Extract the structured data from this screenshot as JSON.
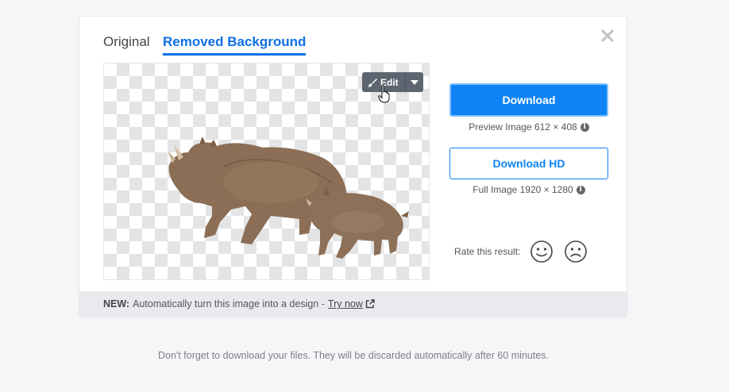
{
  "tabs": {
    "original": "Original",
    "removed_background": "Removed Background"
  },
  "preview": {
    "edit_label": "Edit",
    "edit_icon": "brush-icon",
    "dropdown_icon": "caret-down-icon"
  },
  "download": {
    "button_label": "Download",
    "preview_caption": "Preview Image 612 × 408",
    "hd_button_label": "Download HD",
    "hd_caption": "Full Image 1920 × 1280"
  },
  "rating": {
    "label": "Rate this result:",
    "positive_icon": "smiley-face-icon",
    "negative_icon": "sad-face-icon"
  },
  "footer": {
    "new_tag": "NEW:",
    "text": "Automatically turn this image into a design -",
    "link": "Try now"
  },
  "bottom_note": "Don't forget to download your files. They will be discarded automatically after 60 minutes.",
  "colors": {
    "accent": "#0f83f5",
    "tab_active": "#0f70e6",
    "footer_bg": "#e8eaed",
    "edit_bg": "#5c6570"
  }
}
